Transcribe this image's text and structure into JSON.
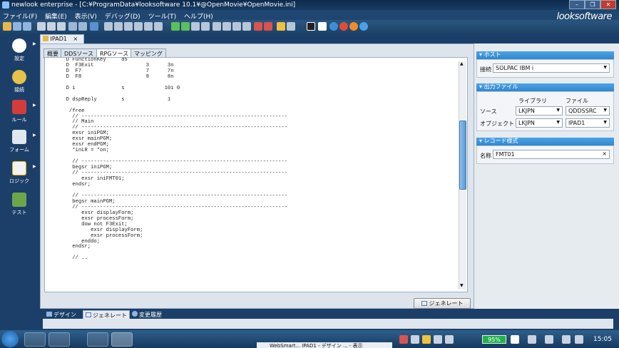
{
  "window": {
    "title": "newlook enterprise - [C:¥ProgramData¥looksoftware 10.1¥@OpenMovie¥OpenMovie.ini]",
    "brand": "looksoftware"
  },
  "menu": [
    "ファイル(F)",
    "編集(E)",
    "表示(V)",
    "デバッグ(D)",
    "ツール(T)",
    "ヘルプ(H)"
  ],
  "left_nav": [
    {
      "label": "設定",
      "icon": "gear-icon"
    },
    {
      "label": "接続",
      "icon": "person-icon"
    },
    {
      "label": "ルール",
      "icon": "rules-icon"
    },
    {
      "label": "フォーム",
      "icon": "form-icon"
    },
    {
      "label": "ロジック",
      "icon": "lightning-icon"
    },
    {
      "label": "テスト",
      "icon": "stamp-icon"
    }
  ],
  "document_tab": {
    "label": "IPAD1",
    "close": "×"
  },
  "subtabs": [
    "概要",
    "DDSソース",
    "RPGソース",
    "マッピング"
  ],
  "active_subtab": "RPGソース",
  "code": "     D FunctionKey     ds\n     D  F3Exit                 3      3n\n     D  F7                     7      7n\n     D  F8                     8      8n\n\n     D i               s             10i 0\n\n     D dspReply        s              1\n\n      /free\n       // -------------------------------------------------------------------\n       // Main\n       // -------------------------------------------------------------------\n       exsr iniPGM;\n       exsr mainPGM;\n       exsr endPGM;\n       *inLR = *on;\n\n       // -------------------------------------------------------------------\n       begsr iniPGM;\n       // -------------------------------------------------------------------\n          exsr iniFMT01;\n       endsr;\n\n       // -------------------------------------------------------------------\n       begsr mainPGM;\n       // -------------------------------------------------------------------\n          exsr displayForm;\n          exsr processForm;\n          dow not F3Exit;\n             exsr displayForm;\n             exsr processForm;\n          enddo;\n       endsr;\n\n       // ..",
  "generate_button": "ジェネレート",
  "bottom_tabs": [
    {
      "label": "デザイン",
      "icon": "design-icon"
    },
    {
      "label": "ジェネレート",
      "icon": "generate-icon"
    },
    {
      "label": "変更履歴",
      "icon": "history-icon"
    }
  ],
  "right_panel": {
    "host": {
      "header": "ホスト",
      "connection_label": "接続",
      "connection_value": "SOLPAC IBM i"
    },
    "output": {
      "header": "出力ファイル",
      "col_library": "ライブラリ",
      "col_file": "ファイル",
      "rows": [
        {
          "label": "ソース",
          "library": "LKJPN",
          "file": "QDDSSRC"
        },
        {
          "label": "オブジェクト",
          "library": "LKJPN",
          "file": "IPAD1"
        }
      ]
    },
    "record": {
      "header": "レコード様式",
      "name_label": "名称",
      "name_value": "FMT01"
    }
  },
  "taskbar": {
    "battery": "95%",
    "clock": "15:05",
    "notification": "WebSmart...   IPAD1 - デザイン ... - 表示"
  }
}
